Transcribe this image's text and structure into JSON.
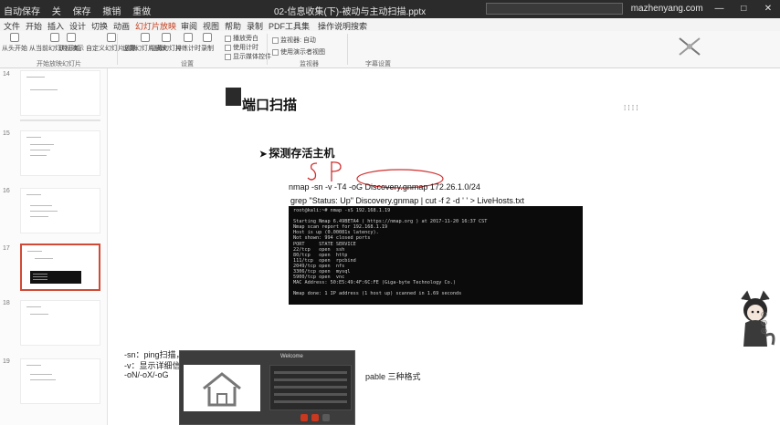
{
  "titlebar": {
    "left_items": [
      "自动保存",
      "关",
      "保存",
      "撤销",
      "重做"
    ],
    "title": "02-信息收集(下)-被动与主动扫描.pptx",
    "right_user": "mazhenyang.com",
    "window_buttons": [
      "—",
      "□",
      "✕"
    ]
  },
  "menu": {
    "tabs": [
      "文件",
      "开始",
      "插入",
      "设计",
      "切换",
      "动画",
      "幻灯片放映",
      "审阅",
      "视图",
      "帮助",
      "录制",
      "PDF工具集",
      "操作说明搜索"
    ],
    "active_index": 6
  },
  "ribbon": {
    "buttons": [
      "从头开始",
      "从当前幻灯片开始",
      "联机演示",
      "自定义幻灯片放映",
      "设置幻灯片放映",
      "隐藏幻灯片",
      "排练计时",
      "录制"
    ],
    "checks": [
      "播放旁白",
      "使用计时",
      "显示媒体控件"
    ],
    "monitor": [
      "监视器: 自动",
      "使用演示者视图"
    ],
    "groups": [
      "开始放映幻灯片",
      "设置",
      "监视器",
      "字幕设置"
    ]
  },
  "thumbnails": [
    {
      "num": "14",
      "selected": false
    },
    {
      "num": "15",
      "selected": false
    },
    {
      "num": "16",
      "selected": false
    },
    {
      "num": "17",
      "selected": true
    },
    {
      "num": "18",
      "selected": false
    },
    {
      "num": "19",
      "selected": false
    }
  ],
  "slide": {
    "title": "端口扫描",
    "subtitle": "探测存活主机",
    "cmd1": "nmap -sn -v -T4 -oG Discovery.gnmap 172.26.1.0/24",
    "cmd2": "grep \"Status: Up\" Discovery.gnmap | cut -f 2 -d ' ' > LiveHosts.txt",
    "handwriting": "S P",
    "notes": [
      "-sn：ping扫描，不进行端口扫描",
      "-v：显示详细信息",
      "-oN/-oX/-oG"
    ],
    "notes_tail": "pable 三种格式"
  },
  "terminal": {
    "lines": [
      "root@kali:~# nmap -sS 192.168.1.19",
      "",
      "Starting Nmap 6.49BETA4 ( https://nmap.org ) at 2017-11-20 16:37 CST",
      "Nmap scan report for 192.168.1.19",
      "Host is up (0.00081s latency).",
      "Not shown: 994 closed ports",
      "PORT     STATE SERVICE",
      "22/tcp   open  ssh",
      "80/tcp   open  http",
      "111/tcp  open  rpcbind",
      "2049/tcp open  nfs",
      "3306/tcp open  mysql",
      "5900/tcp open  vnc",
      "MAC Address: 50:E5:49:4F:6C:FE (Giga-byte Technology Co.)",
      "",
      "Nmap done: 1 IP address (1 host up) scanned in 1.69 seconds"
    ]
  },
  "popup": {
    "title": "Welcome",
    "icon": "house-icon",
    "buttons": [
      "#c9381f",
      "#c9381f",
      "#5a5a5a"
    ]
  }
}
